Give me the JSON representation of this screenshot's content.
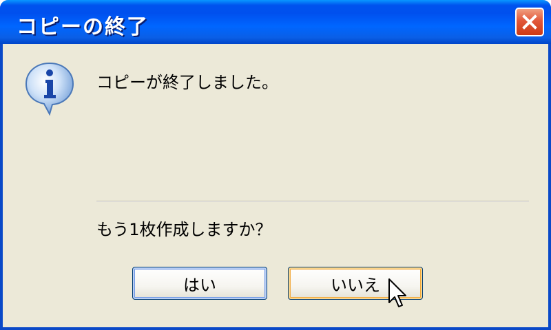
{
  "window": {
    "title": "コピーの終了"
  },
  "dialog": {
    "message": "コピーが終了しました。",
    "question": "もう1枚作成しますか？",
    "icon": "info-icon"
  },
  "buttons": {
    "yes_label": "はい",
    "no_label": "いいえ"
  },
  "colors": {
    "titlebar": "#0053ee",
    "close_button": "#e2583a",
    "dialog_background": "#ece9d8"
  }
}
